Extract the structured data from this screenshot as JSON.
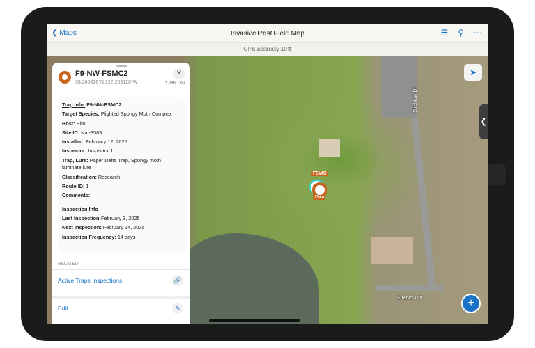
{
  "header": {
    "back_label": "Maps",
    "title": "Invasive Pest Field Map",
    "gps": "GPS accuracy 10 ft"
  },
  "map": {
    "pin_top_label": "FSMC",
    "pin_bottom_label": "Dua",
    "street_labels": [
      "Streblow Dr",
      "Streblow Dr"
    ]
  },
  "feature": {
    "name": "F9-NW-FSMC2",
    "coords": "38.266828°N 122.263120°W",
    "distance": "2,286.1 mi",
    "lines": [
      {
        "label": "Trap Info:",
        "value": " F9-NW-FSMC2",
        "heading": true
      },
      {
        "label": "Target Species:",
        "value": " Flighted Spongy Moth Complex"
      },
      {
        "label": "Host:",
        "value": " Elm"
      },
      {
        "label": "Site ID:",
        "value": " Nat-3589"
      },
      {
        "label": "Installed:",
        "value": " February 12, 2025"
      },
      {
        "label": "Inspector:",
        "value": " Inspector 1"
      },
      {
        "label": "Trap, Lure:",
        "value": " Paper Delta Trap, Spongy moth laminate lure"
      },
      {
        "label": "Classification:",
        "value": " Research"
      },
      {
        "label": "Route ID:",
        "value": " 1"
      },
      {
        "label": "Comments:",
        "value": ""
      },
      {
        "label": "Inspection Info",
        "value": "",
        "heading": true,
        "section": true
      },
      {
        "label": "Last Inspection:",
        "value": "February 3, 2025"
      },
      {
        "label": "Next Inspection:",
        "value": " February 14, 2025"
      },
      {
        "label": "Inspection Frequency:",
        "value": " 14 days"
      }
    ]
  },
  "related": {
    "label": "RELATED",
    "items": [
      {
        "label": "Active Traps Inspections",
        "icon": "link-icon"
      },
      {
        "label": "Edit",
        "icon": "pencil-icon"
      }
    ]
  },
  "colors": {
    "accent": "#1a72c6",
    "pin": "#c9641c",
    "highlight": "#2ad6d3"
  }
}
